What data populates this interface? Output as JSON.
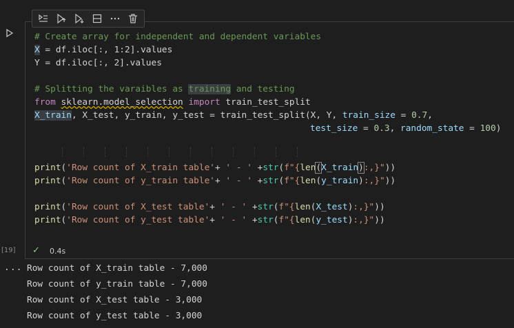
{
  "toolbar": {
    "buttons": [
      "run-by-line",
      "execute-above",
      "execute-below",
      "split-cell",
      "more-actions",
      "delete-cell"
    ]
  },
  "cell": {
    "execution_count": "[19]",
    "status_time": "0.4s",
    "code": {
      "l1": "# Create array for independent and dependent variables",
      "l2a": "X",
      "l2b": " = df.iloc[:, 1:2].values",
      "l3": "Y = df.iloc[:, 2].values",
      "l5a": "# Splitting the varaibles as ",
      "l5b": "training",
      "l5c": " and testing",
      "l6_from": "from",
      "l6_mod": "sklearn.model_selection",
      "l6_import": "import",
      "l6_name": "train_test_split",
      "l7a": "X_train",
      "l7b": ", X_test, y_train, y_test = ",
      "l7c": "train_test_split",
      "l7d": "(X, Y, ",
      "l7e": "train_size",
      "l7f": " = ",
      "l7g": "0.7",
      "l7h": ",",
      "l8a": "test_size",
      "l8b": " = ",
      "l8c": "0.3",
      "l8d": ", ",
      "l8e": "random_state",
      "l8f": " = ",
      "l8g": "100",
      "l8h": ")",
      "print": "print",
      "str_fn": "str",
      "len_fn": "len",
      "p1_str": "'Row count of X_train table'",
      "p2_str": "'Row count of y_train table'",
      "p3_str": "'Row count of X_test table'",
      "p4_str": "'Row count of y_test table'",
      "sep_str": "' - '",
      "f_open": "f\"{",
      "f_close": ":,}\"",
      "arg1": "X_train",
      "arg2": "y_train",
      "arg3": "X_test",
      "arg4": "y_test"
    }
  },
  "output": {
    "lines": [
      "Row count of X_train table - 7,000",
      "Row count of y_train table - 7,000",
      "Row count of X_test table - 3,000",
      "Row count of y_test table - 3,000"
    ]
  },
  "colors": {
    "background": "#1e1e1e",
    "comment": "#6a9955",
    "variable": "#9cdcfe",
    "function": "#dcdcaa",
    "string": "#ce9178",
    "keyword": "#c586c0",
    "number": "#b5cea8",
    "success": "#89d185"
  }
}
